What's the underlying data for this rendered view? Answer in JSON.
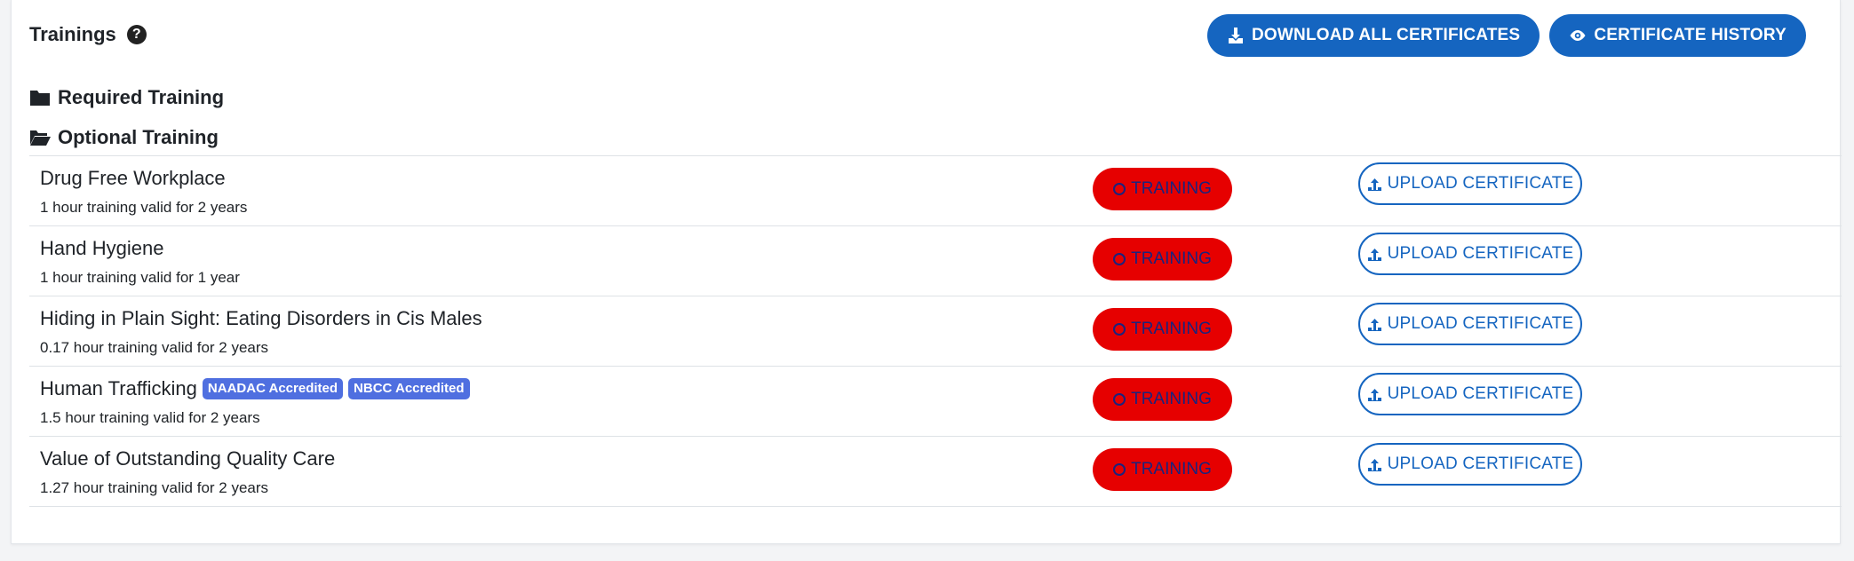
{
  "header": {
    "title": "Trainings",
    "help_icon": "question-circle-icon",
    "download_all_label": "DOWNLOAD ALL CERTIFICATES",
    "certificate_history_label": "CERTIFICATE HISTORY"
  },
  "folders": {
    "required": "Required Training",
    "optional": "Optional Training"
  },
  "trainings": [
    {
      "name": "Drug Free Workplace",
      "detail": "1 hour training valid for 2 years",
      "badges": [],
      "status": "TRAINING",
      "action": "UPLOAD CERTIFICATE"
    },
    {
      "name": "Hand Hygiene",
      "detail": "1 hour training valid for 1 year",
      "badges": [],
      "status": "TRAINING",
      "action": "UPLOAD CERTIFICATE"
    },
    {
      "name": "Hiding in Plain Sight: Eating Disorders in Cis Males",
      "detail": "0.17 hour training valid for 2 years",
      "badges": [],
      "status": "TRAINING",
      "action": "UPLOAD CERTIFICATE"
    },
    {
      "name": "Human Trafficking",
      "detail": "1.5 hour training valid for 2 years",
      "badges": [
        "NAADAC Accredited",
        "NBCC Accredited"
      ],
      "status": "TRAINING",
      "action": "UPLOAD CERTIFICATE"
    },
    {
      "name": "Value of Outstanding Quality Care",
      "detail": "1.27 hour training valid for 2 years",
      "badges": [],
      "status": "TRAINING",
      "action": "UPLOAD CERTIFICATE"
    }
  ],
  "colors": {
    "primary": "#1565c0",
    "status_red": "#e60000",
    "badge": "#4f6fe0"
  }
}
